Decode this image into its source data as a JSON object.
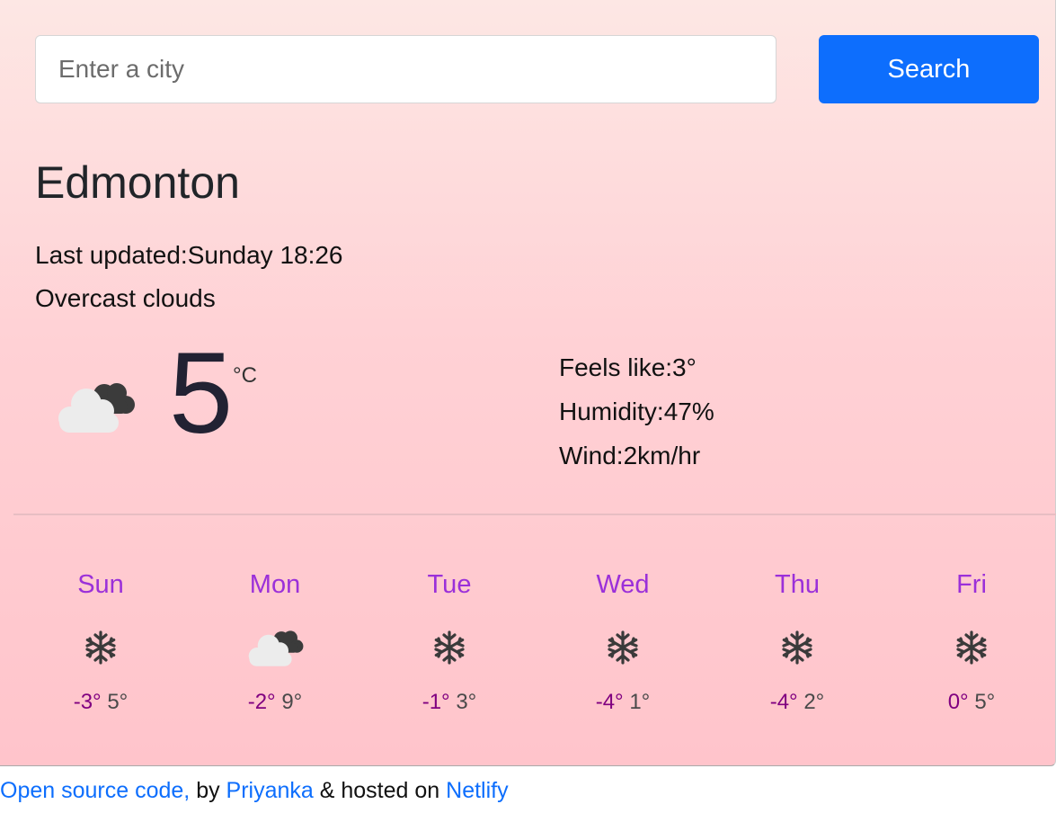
{
  "search": {
    "placeholder": "Enter a city",
    "value": "",
    "button_label": "Search"
  },
  "current": {
    "city": "Edmonton",
    "last_updated": "Last updated:Sunday 18:26",
    "description": "Overcast clouds",
    "icon": "overcast-clouds-icon",
    "temperature": "5",
    "unit": "°C",
    "feels_like": "Feels like:3°",
    "humidity": "Humidity:47%",
    "wind": "Wind:2km/hr"
  },
  "forecast": [
    {
      "day": "Sun",
      "icon": "snow-icon",
      "min": "-3°",
      "max": "5°"
    },
    {
      "day": "Mon",
      "icon": "overcast-clouds-icon",
      "min": "-2°",
      "max": "9°"
    },
    {
      "day": "Tue",
      "icon": "snow-icon",
      "min": "-1°",
      "max": "3°"
    },
    {
      "day": "Wed",
      "icon": "snow-icon",
      "min": "-4°",
      "max": "1°"
    },
    {
      "day": "Thu",
      "icon": "snow-icon",
      "min": "-4°",
      "max": "2°"
    },
    {
      "day": "Fri",
      "icon": "snow-icon",
      "min": "0°",
      "max": "5°"
    }
  ],
  "footer": {
    "source_link": "Open source code,",
    "by_text": " by ",
    "author_link": "Priyanka",
    "hosted_text": " & hosted on ",
    "host_link": "Netlify"
  },
  "colors": {
    "accent": "#0d6efd",
    "day_name": "#9b30d9",
    "temp_min": "#800080"
  }
}
